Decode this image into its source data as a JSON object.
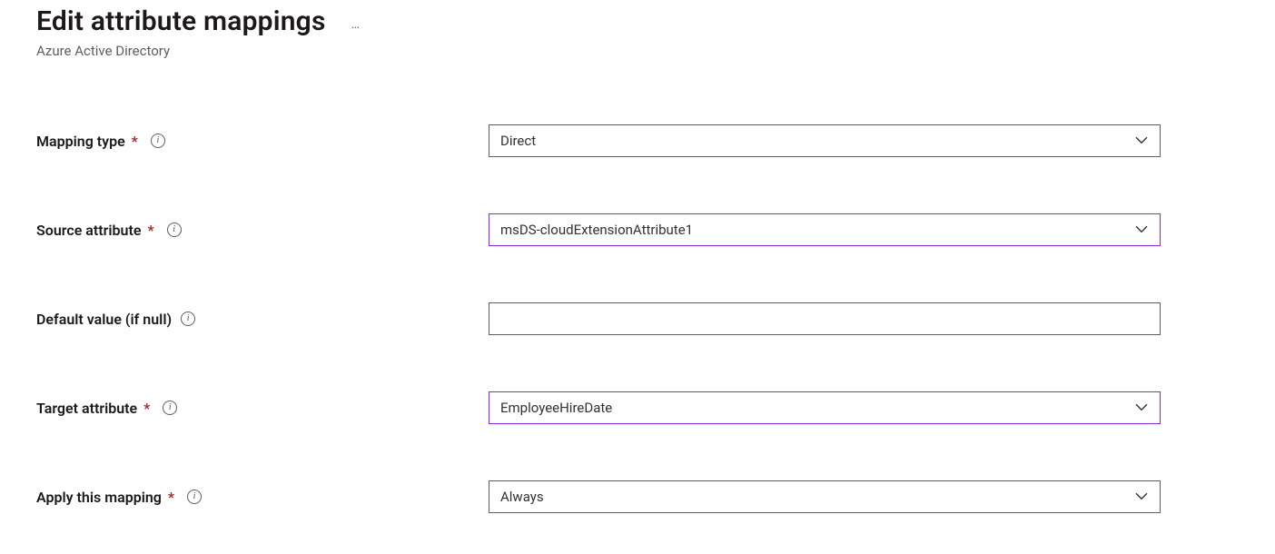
{
  "header": {
    "title": "Edit attribute mappings",
    "more": "…",
    "subtitle": "Azure Active Directory"
  },
  "fields": {
    "mapping_type": {
      "label": "Mapping type",
      "required": true,
      "value": "Direct",
      "type": "select",
      "highlight": false
    },
    "source_attr": {
      "label": "Source attribute",
      "required": true,
      "value": "msDS-cloudExtensionAttribute1",
      "type": "select",
      "highlight": true
    },
    "default_val": {
      "label": "Default value (if null)",
      "required": false,
      "value": "",
      "type": "text",
      "highlight": false
    },
    "target_attr": {
      "label": "Target attribute",
      "required": true,
      "value": "EmployeeHireDate",
      "type": "select",
      "highlight": true
    },
    "apply_mapping": {
      "label": "Apply this mapping",
      "required": true,
      "value": "Always",
      "type": "select",
      "highlight": false
    }
  },
  "glyphs": {
    "info": "i",
    "required": "*"
  }
}
